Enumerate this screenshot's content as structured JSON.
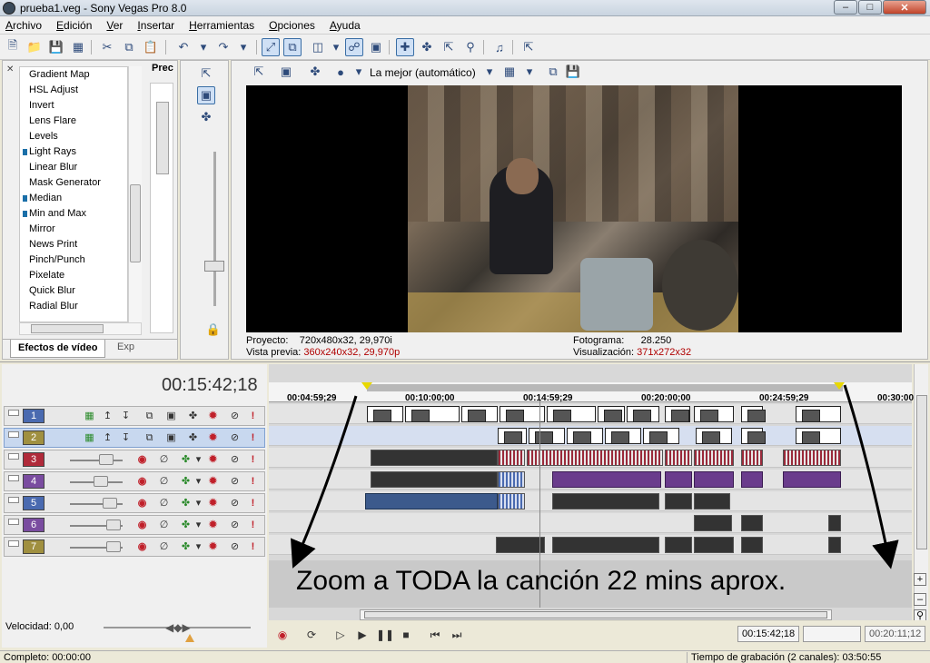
{
  "window": {
    "title": "prueba1.veg - Sony Vegas Pro 8.0"
  },
  "menu": [
    "Archivo",
    "Edición",
    "Ver",
    "Insertar",
    "Herramientas",
    "Opciones",
    "Ayuda"
  ],
  "effects": {
    "items": [
      {
        "label": "Gradient Map",
        "marked": false
      },
      {
        "label": "HSL Adjust",
        "marked": false
      },
      {
        "label": "Invert",
        "marked": false
      },
      {
        "label": "Lens Flare",
        "marked": false
      },
      {
        "label": "Levels",
        "marked": false
      },
      {
        "label": "Light Rays",
        "marked": true
      },
      {
        "label": "Linear Blur",
        "marked": false
      },
      {
        "label": "Mask Generator",
        "marked": false
      },
      {
        "label": "Median",
        "marked": true
      },
      {
        "label": "Min and Max",
        "marked": true
      },
      {
        "label": "Mirror",
        "marked": false
      },
      {
        "label": "News Print",
        "marked": false
      },
      {
        "label": "Pinch/Punch",
        "marked": false
      },
      {
        "label": "Pixelate",
        "marked": false
      },
      {
        "label": "Quick Blur",
        "marked": false
      },
      {
        "label": "Radial Blur",
        "marked": false
      }
    ],
    "prec_label": "Prec",
    "tab_active": "Efectos de vídeo",
    "tab_other": "Exp"
  },
  "preview": {
    "quality": "La mejor (automático)",
    "proyecto_label": "Proyecto:",
    "proyecto_value": "720x480x32, 29,970i",
    "vista_label": "Vista previa:",
    "vista_value": "360x240x32, 29,970p",
    "fotograma_label": "Fotograma:",
    "fotograma_value": "28.250",
    "visualizacion_label": "Visualización:",
    "visualizacion_value": "371x272x32"
  },
  "timeline": {
    "timecode": "00:15:42;18",
    "ruler": [
      "00:04:59;29",
      "00:10:00;00",
      "00:14:59;29",
      "00:20:00;00",
      "00:24:59;29",
      "00:30:00"
    ],
    "tracks": [
      "1",
      "2",
      "3",
      "4",
      "5",
      "6",
      "7"
    ],
    "track_colors": [
      "#4a6ab0",
      "#a09040",
      "#b02a3a",
      "#7a4ca0",
      "#4a6ab0",
      "#7a4ca0",
      "#a09040"
    ],
    "overlay_text": "Zoom a TODA la canción 22 mins aprox.",
    "cursor_time": "00:15:42;18",
    "end_time": "00:20:11;12"
  },
  "speed": {
    "label": "Velocidad: 0,00"
  },
  "status": {
    "left": "Completo: 00:00:00",
    "right": "Tiempo de grabación (2 canales): 03:50:55"
  }
}
